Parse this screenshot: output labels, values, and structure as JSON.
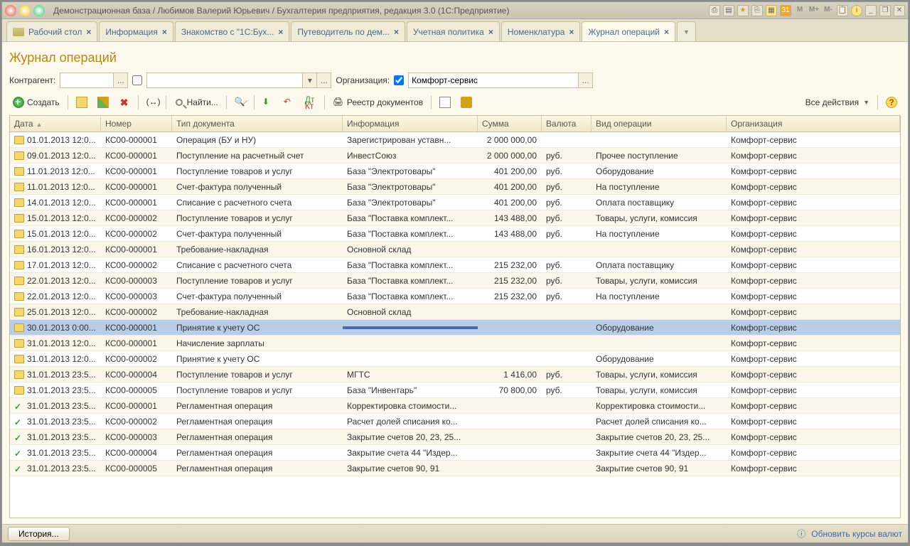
{
  "window_title": "Демонстрационная база / Любимов Валерий Юрьевич / Бухгалтерия предприятия, редакция 3.0  (1С:Предприятие)",
  "tabs": [
    {
      "label": "Рабочий стол",
      "has_icon": true
    },
    {
      "label": "Информация"
    },
    {
      "label": "Знакомство с \"1С:Бух..."
    },
    {
      "label": "Путеводитель по дем..."
    },
    {
      "label": "Учетная политика"
    },
    {
      "label": "Номенклатура"
    },
    {
      "label": "Журнал операций",
      "active": true
    }
  ],
  "page_title": "Журнал операций",
  "filter": {
    "contragent_label": "Контрагент:",
    "contragent_value": "",
    "org_label": "Организация:",
    "org_checked": true,
    "org_value": "Комфорт-сервис"
  },
  "toolbar": {
    "create": "Создать",
    "find": "Найти...",
    "registry": "Реестр документов",
    "all_actions": "Все действия"
  },
  "columns": [
    "Дата",
    "Номер",
    "Тип документа",
    "Информация",
    "Сумма",
    "Валюта",
    "Вид операции",
    "Организация"
  ],
  "rows": [
    {
      "ic": "d",
      "date": "01.01.2013 12:0...",
      "num": "КС00-000001",
      "type": "Операция (БУ и НУ)",
      "info": "Зарегистрирован уставн...",
      "sum": "2 000 000,00",
      "cur": "",
      "op": "",
      "org": "Комфорт-сервис"
    },
    {
      "ic": "d",
      "date": "09.01.2013 12:0...",
      "num": "КС00-000001",
      "type": "Поступление на расчетный счет",
      "info": "ИнвестСоюз",
      "sum": "2 000 000,00",
      "cur": "руб.",
      "op": "Прочее поступление",
      "org": "Комфорт-сервис"
    },
    {
      "ic": "d",
      "date": "11.01.2013 12:0...",
      "num": "КС00-000001",
      "type": "Поступление товаров и услуг",
      "info": "База \"Электротовары\"",
      "sum": "401 200,00",
      "cur": "руб.",
      "op": "Оборудование",
      "org": "Комфорт-сервис"
    },
    {
      "ic": "d",
      "date": "11.01.2013 12:0...",
      "num": "КС00-000001",
      "type": "Счет-фактура полученный",
      "info": "База \"Электротовары\"",
      "sum": "401 200,00",
      "cur": "руб.",
      "op": "На поступление",
      "org": "Комфорт-сервис"
    },
    {
      "ic": "d",
      "date": "14.01.2013 12:0...",
      "num": "КС00-000001",
      "type": "Списание с расчетного счета",
      "info": "База \"Электротовары\"",
      "sum": "401 200,00",
      "cur": "руб.",
      "op": "Оплата поставщику",
      "org": "Комфорт-сервис"
    },
    {
      "ic": "d",
      "date": "15.01.2013 12:0...",
      "num": "КС00-000002",
      "type": "Поступление товаров и услуг",
      "info": "База \"Поставка комплект...",
      "sum": "143 488,00",
      "cur": "руб.",
      "op": "Товары, услуги, комиссия",
      "org": "Комфорт-сервис"
    },
    {
      "ic": "d",
      "date": "15.01.2013 12:0...",
      "num": "КС00-000002",
      "type": "Счет-фактура полученный",
      "info": "База \"Поставка комплект...",
      "sum": "143 488,00",
      "cur": "руб.",
      "op": "На поступление",
      "org": "Комфорт-сервис"
    },
    {
      "ic": "d",
      "date": "16.01.2013 12:0...",
      "num": "КС00-000001",
      "type": "Требование-накладная",
      "info": "Основной склад",
      "sum": "",
      "cur": "",
      "op": "",
      "org": "Комфорт-сервис"
    },
    {
      "ic": "d",
      "date": "17.01.2013 12:0...",
      "num": "КС00-000002",
      "type": "Списание с расчетного счета",
      "info": "База \"Поставка комплект...",
      "sum": "215 232,00",
      "cur": "руб.",
      "op": "Оплата поставщику",
      "org": "Комфорт-сервис"
    },
    {
      "ic": "d",
      "date": "22.01.2013 12:0...",
      "num": "КС00-000003",
      "type": "Поступление товаров и услуг",
      "info": "База \"Поставка комплект...",
      "sum": "215 232,00",
      "cur": "руб.",
      "op": "Товары, услуги, комиссия",
      "org": "Комфорт-сервис"
    },
    {
      "ic": "d",
      "date": "22.01.2013 12:0...",
      "num": "КС00-000003",
      "type": "Счет-фактура полученный",
      "info": "База \"Поставка комплект...",
      "sum": "215 232,00",
      "cur": "руб.",
      "op": "На поступление",
      "org": "Комфорт-сервис"
    },
    {
      "ic": "d",
      "date": "25.01.2013 12:0...",
      "num": "КС00-000002",
      "type": "Требование-накладная",
      "info": "Основной склад",
      "sum": "",
      "cur": "",
      "op": "",
      "org": "Комфорт-сервис"
    },
    {
      "ic": "d",
      "date": "30.01.2013 0:00...",
      "num": "КС00-000001",
      "type": "Принятие к учету ОС",
      "info": "",
      "sum": "",
      "cur": "",
      "op": "Оборудование",
      "org": "Комфорт-сервис",
      "sel": true
    },
    {
      "ic": "d",
      "date": "31.01.2013 12:0...",
      "num": "КС00-000001",
      "type": "Начисление зарплаты",
      "info": "",
      "sum": "",
      "cur": "",
      "op": "",
      "org": "Комфорт-сервис"
    },
    {
      "ic": "d",
      "date": "31.01.2013 12:0...",
      "num": "КС00-000002",
      "type": "Принятие к учету ОС",
      "info": "",
      "sum": "",
      "cur": "",
      "op": "Оборудование",
      "org": "Комфорт-сервис"
    },
    {
      "ic": "d",
      "date": "31.01.2013 23:5...",
      "num": "КС00-000004",
      "type": "Поступление товаров и услуг",
      "info": "МГТС",
      "sum": "1 416,00",
      "cur": "руб.",
      "op": "Товары, услуги, комиссия",
      "org": "Комфорт-сервис"
    },
    {
      "ic": "d",
      "date": "31.01.2013 23:5...",
      "num": "КС00-000005",
      "type": "Поступление товаров и услуг",
      "info": "База \"Инвентарь\"",
      "sum": "70 800,00",
      "cur": "руб.",
      "op": "Товары, услуги, комиссия",
      "org": "Комфорт-сервис"
    },
    {
      "ic": "c",
      "date": "31.01.2013 23:5...",
      "num": "КС00-000001",
      "type": "Регламентная операция",
      "info": "Корректировка стоимости...",
      "sum": "",
      "cur": "",
      "op": "Корректировка стоимости...",
      "org": "Комфорт-сервис"
    },
    {
      "ic": "c",
      "date": "31.01.2013 23:5...",
      "num": "КС00-000002",
      "type": "Регламентная операция",
      "info": "Расчет долей списания ко...",
      "sum": "",
      "cur": "",
      "op": "Расчет долей списания ко...",
      "org": "Комфорт-сервис"
    },
    {
      "ic": "c",
      "date": "31.01.2013 23:5...",
      "num": "КС00-000003",
      "type": "Регламентная операция",
      "info": "Закрытие счетов 20, 23, 25...",
      "sum": "",
      "cur": "",
      "op": "Закрытие счетов 20, 23, 25...",
      "org": "Комфорт-сервис"
    },
    {
      "ic": "c",
      "date": "31.01.2013 23:5...",
      "num": "КС00-000004",
      "type": "Регламентная операция",
      "info": "Закрытие счета 44 \"Издер...",
      "sum": "",
      "cur": "",
      "op": "Закрытие счета 44 \"Издер...",
      "org": "Комфорт-сервис"
    },
    {
      "ic": "c",
      "date": "31.01.2013 23:5...",
      "num": "КС00-000005",
      "type": "Регламентная операция",
      "info": "Закрытие счетов 90, 91",
      "sum": "",
      "cur": "",
      "op": "Закрытие счетов 90, 91",
      "org": "Комфорт-сервис"
    }
  ],
  "status": {
    "history": "История...",
    "update_rates": "Обновить курсы валют"
  },
  "titlebar_letters": [
    "M",
    "M+",
    "M-"
  ]
}
